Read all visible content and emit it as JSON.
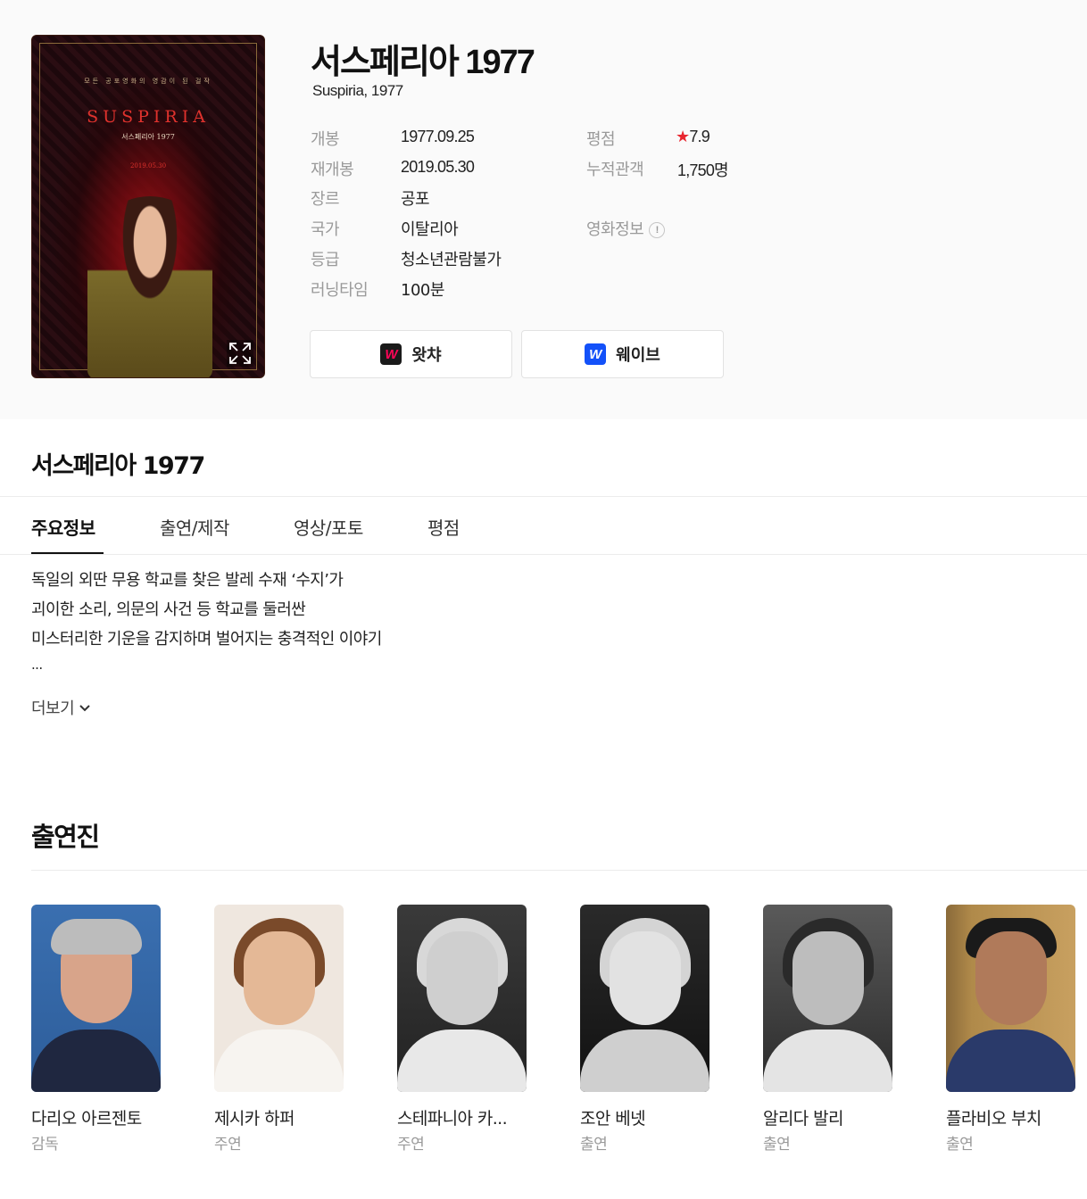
{
  "movie": {
    "title": "서스페리아 1977",
    "subtitle": "Suspiria, 1977",
    "poster": {
      "tagline": "모든 공포영화의 영감이 된 걸작",
      "title": "SUSPIRIA",
      "subtitle": "서스페리아 1977",
      "date": "2019.05.30"
    }
  },
  "info": {
    "left": [
      {
        "label": "개봉",
        "value": "1977.09.25"
      },
      {
        "label": "재개봉",
        "value": "2019.05.30"
      },
      {
        "label": "장르",
        "value": "공포"
      },
      {
        "label": "국가",
        "value": "이탈리아"
      },
      {
        "label": "등급",
        "value": "청소년관람불가"
      },
      {
        "label": "러닝타임",
        "value": "100분"
      }
    ],
    "right": {
      "rating_label": "평점",
      "rating_star": "★",
      "rating_value": "7.9",
      "audience_label": "누적관객",
      "audience_value": "1,750명",
      "movieinfo_label": "영화정보",
      "movieinfo_icon": "!"
    }
  },
  "ott": [
    {
      "name": "왓챠",
      "logo_letter": "W",
      "icon": "watcha-logo-icon"
    },
    {
      "name": "웨이브",
      "logo_letter": "W",
      "icon": "wavve-logo-icon"
    }
  ],
  "section": {
    "title": "서스페리아 1977",
    "tabs": [
      "주요정보",
      "출연/제작",
      "영상/포토",
      "평점"
    ],
    "active_tab": "주요정보"
  },
  "synopsis": {
    "lines": [
      "독일의 외딴 무용 학교를 찾은 발레 수재 ‘수지’가",
      "괴이한 소리, 의문의 사건 등 학교를 둘러싼",
      "미스터리한 기운을 감지하며 벌어지는 충격적인 이야기",
      "..."
    ],
    "more_label": "더보기"
  },
  "cast": {
    "title": "출연진",
    "members": [
      {
        "name": "다리오 아르젠토",
        "role": "감독"
      },
      {
        "name": "제시카 하퍼",
        "role": "주연"
      },
      {
        "name": "스테파니아 카...",
        "role": "주연"
      },
      {
        "name": "조안 베넷",
        "role": "출연"
      },
      {
        "name": "알리다 발리",
        "role": "출연"
      },
      {
        "name": "플라비오 부치",
        "role": "출연"
      }
    ]
  },
  "colors": {
    "star": "#e8262f",
    "wavve": "#1351f9",
    "watcha": "#ff0558"
  }
}
